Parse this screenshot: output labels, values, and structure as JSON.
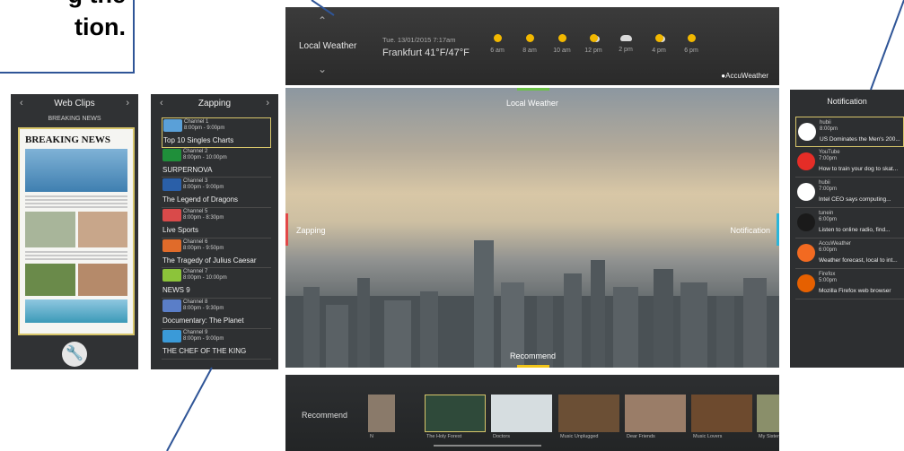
{
  "callout": {
    "text": "g the\ntion."
  },
  "weather": {
    "title": "Local Weather",
    "date": "Tue. 13/01/2015  7:17am",
    "location": "Frankfurt  41°F/47°F",
    "hours": [
      {
        "time": "6 am",
        "icon": "sun-icon"
      },
      {
        "time": "8 am",
        "icon": "sun-icon"
      },
      {
        "time": "10 am",
        "icon": "sun-icon"
      },
      {
        "time": "12 pm",
        "icon": "partly-cloudy-icon"
      },
      {
        "time": "2 pm",
        "icon": "cloud-icon"
      },
      {
        "time": "4 pm",
        "icon": "partly-cloudy-icon"
      },
      {
        "time": "6 pm",
        "icon": "sun-icon"
      }
    ],
    "brand": "AccuWeather"
  },
  "main_view": {
    "top_label": "Local Weather",
    "left_label": "Zapping",
    "right_label": "Notification",
    "bottom_label": "Recommend"
  },
  "webclips": {
    "title": "Web Clips",
    "subtitle": "BREAKING NEWS",
    "paper_title": "BREAKING NEWS"
  },
  "zapping": {
    "title": "Zapping",
    "channels": [
      {
        "channel": "Channel 1",
        "time": "8:00pm - 9:00pm",
        "title": "Top 10 Singles Charts",
        "selected": true
      },
      {
        "channel": "Channel 2",
        "time": "8:00pm - 10:00pm",
        "title": "SURPERNOVA"
      },
      {
        "channel": "Channel 3",
        "time": "8:00pm - 9:00pm",
        "title": "The Legend of Dragons"
      },
      {
        "channel": "Channel 5",
        "time": "8:00pm - 8:30pm",
        "title": "Live Sports"
      },
      {
        "channel": "Channel 6",
        "time": "8:00pm - 9:50pm",
        "title": "The Tragedy of Julius Caesar"
      },
      {
        "channel": "Channel 7",
        "time": "8:00pm - 10:00pm",
        "title": "NEWS 9"
      },
      {
        "channel": "Channel 8",
        "time": "8:00pm - 9:30pm",
        "title": "Documentary: The Planet"
      },
      {
        "channel": "Channel 9",
        "time": "8:00pm - 9:00pm",
        "title": "THE CHEF OF THE KING"
      }
    ]
  },
  "notifications": {
    "title": "Notification",
    "items": [
      {
        "app": "hubii",
        "time": "8:00pm",
        "message": "US Dominates the Men's 200...",
        "icon": "hubii-icon",
        "color": "#ffffff",
        "selected": true
      },
      {
        "app": "YouTube",
        "time": "7:00pm",
        "message": "How to train your dog to skat...",
        "icon": "youtube-icon",
        "color": "#e52d27"
      },
      {
        "app": "hubii",
        "time": "7:00pm",
        "message": "Intel CEO says computing...",
        "icon": "hubii-icon",
        "color": "#ffffff"
      },
      {
        "app": "tunein",
        "time": "6:00pm",
        "message": "Listen to online radio, find...",
        "icon": "tunein-icon",
        "color": "#1a1a1a"
      },
      {
        "app": "AccuWeather",
        "time": "6:00pm",
        "message": "Weather forecast, local to int...",
        "icon": "accuweather-icon",
        "color": "#f26a21"
      },
      {
        "app": "Firefox",
        "time": "5:00pm",
        "message": "Mozilla Firefox web browser",
        "icon": "firefox-icon",
        "color": "#e66000"
      }
    ]
  },
  "recommend": {
    "label": "Recommend",
    "cards": [
      {
        "caption": "N",
        "color": "#8a7a6a"
      },
      {
        "caption": "The Holy Forest",
        "color": "#2f4a3a",
        "selected": true
      },
      {
        "caption": "Doctors",
        "color": "#d6dde0"
      },
      {
        "caption": "Music Unplugged",
        "color": "#6b4f35"
      },
      {
        "caption": "Dear Friends",
        "color": "#9a7d68"
      },
      {
        "caption": "Music Lovers",
        "color": "#6d4a2e"
      },
      {
        "caption": "My Sister",
        "color": "#8a8f6a"
      }
    ]
  }
}
